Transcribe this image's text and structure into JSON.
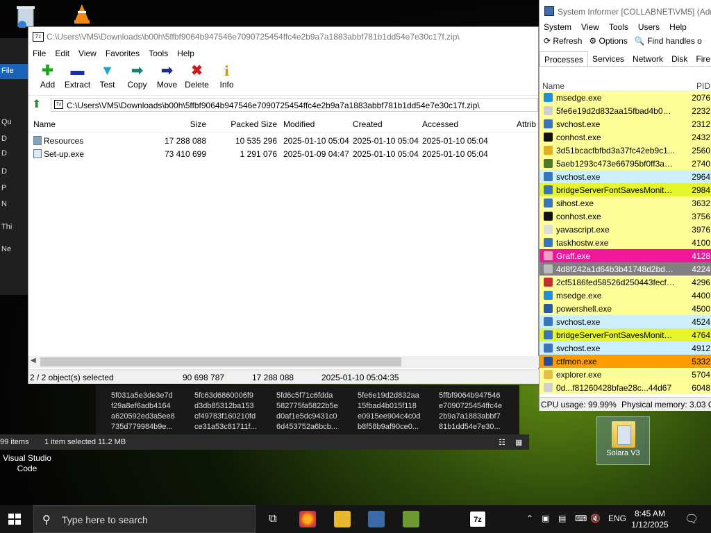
{
  "desktop": {
    "solara_label": "Solara V3",
    "vs_label": "Visual Studio Code"
  },
  "explorer_bg": {
    "file_tab": "File",
    "nav_items": [
      "Qu",
      "D",
      "D",
      "D",
      "P",
      "N",
      "Thi",
      "Ne"
    ],
    "status_items": "99 items",
    "status_selected": "1 item selected  11.2 MB",
    "hash_cols": [
      "5f031a5e3de3e7d\nf29a8ef6adb4164\na620592ed3a5ee8\n735d779984b9e...",
      "5fc63d6860006f9\nd3db85312ba153\ncf49783f160210fd\nce31a53c81711f...",
      "5fd6c5f71c6fdda\n582775fa5822b5e\nd0af1e5dc9431c0\n6d453752a6bcb...",
      "5fe6e19d2d832aa\n15fbad4b015f118\ne0915ee904c4c0d\nb8f58b9af90ce0...",
      "5ffbf9064b947546\ne7090725454ffc4e\n2b9a7a1883abbf7\n81b1dd54e7e30..."
    ]
  },
  "zip": {
    "title": "C:\\Users\\VM5\\Downloads\\b00h\\5ffbf9064b947546e7090725454ffc4e2b9a7a1883abbf781b1dd54e7e30c17f.zip\\",
    "logo": "7z",
    "menu": [
      "File",
      "Edit",
      "View",
      "Favorites",
      "Tools",
      "Help"
    ],
    "toolbar": [
      {
        "label": "Add",
        "icon": "+",
        "color": "#1fa51f"
      },
      {
        "label": "Extract",
        "icon": "▬",
        "color": "#1a2fb0"
      },
      {
        "label": "Test",
        "icon": "▼",
        "color": "#1fa9c9"
      },
      {
        "label": "Copy",
        "icon": "➡",
        "color": "#17807a"
      },
      {
        "label": "Move",
        "icon": "➡",
        "color": "#1a2a8c"
      },
      {
        "label": "Delete",
        "icon": "✖",
        "color": "#d01818"
      },
      {
        "label": "Info",
        "icon": "i",
        "color": "#c8a000"
      }
    ],
    "address": "C:\\Users\\VM5\\Downloads\\b00h\\5ffbf9064b947546e7090725454ffc4e2b9a7a1883abbf781b1dd54e7e30c17f.zip\\",
    "columns": {
      "name": "Name",
      "size": "Size",
      "packed": "Packed Size",
      "modified": "Modified",
      "created": "Created",
      "accessed": "Accessed",
      "attrib": "Attrib"
    },
    "rows": [
      {
        "name": "Resources",
        "size": "17 288 088",
        "packed": "10 535 296",
        "modified": "2025-01-10 05:04",
        "created": "2025-01-10 05:04",
        "accessed": "2025-01-10 05:04",
        "icon": "folder-icon"
      },
      {
        "name": "Set-up.exe",
        "size": "73 410 699",
        "packed": "1 291 076",
        "modified": "2025-01-09 04:47",
        "created": "2025-01-10 05:04",
        "accessed": "2025-01-10 05:04",
        "icon": "exe-icon"
      }
    ],
    "status": {
      "selected": "2 / 2 object(s) selected",
      "size": "90 698 787",
      "packed": "17 288 088",
      "date": "2025-01-10 05:04:35"
    }
  },
  "si": {
    "title": "System Informer [COLLABNET\\VM5] (Adm",
    "menu": [
      "System",
      "View",
      "Tools",
      "Users",
      "Help"
    ],
    "tools": [
      "⟳ Refresh",
      "⚙ Options",
      "🔍 Find handles o"
    ],
    "tabs": [
      "Processes",
      "Services",
      "Network",
      "Disk",
      "Fire"
    ],
    "col_name": "Name",
    "col_pid": "PID",
    "processes": [
      {
        "name": "msedge.exe",
        "pid": "2076",
        "bg": "#ffff99",
        "ic": "#1e8fd8"
      },
      {
        "name": "5fe6e19d2d832aa15fbad4b015...",
        "pid": "2232",
        "bg": "#ffff99",
        "ic": "#d0d0d0"
      },
      {
        "name": "svchost.exe",
        "pid": "2312",
        "bg": "#ffff99",
        "ic": "#3a76c0"
      },
      {
        "name": "conhost.exe",
        "pid": "2432",
        "bg": "#ffff99",
        "ic": "#111111"
      },
      {
        "name": "3d51bcacfbfbd3a37fc42eb9c1...",
        "pid": "2560",
        "bg": "#ffff99",
        "ic": "#e0b020"
      },
      {
        "name": "5aeb1293c473e66795bf0ff3a78...",
        "pid": "2740",
        "bg": "#ffff99",
        "ic": "#4a7a2a"
      },
      {
        "name": "svchost.exe",
        "pid": "2964",
        "bg": "#cdf0ff",
        "ic": "#3a76c0"
      },
      {
        "name": "bridgeServerFontSavesMonito...",
        "pid": "2984",
        "bg": "#e6f52c",
        "ic": "#3a76c0"
      },
      {
        "name": "sihost.exe",
        "pid": "3632",
        "bg": "#ffff99",
        "ic": "#3a76c0"
      },
      {
        "name": "conhost.exe",
        "pid": "3756",
        "bg": "#ffff99",
        "ic": "#111111"
      },
      {
        "name": "yavascript.exe",
        "pid": "3976",
        "bg": "#ffff99",
        "ic": "#dddddd"
      },
      {
        "name": "taskhostw.exe",
        "pid": "4100",
        "bg": "#ffff99",
        "ic": "#3a76c0"
      },
      {
        "name": "Graff.exe",
        "pid": "4128",
        "bg": "#f0179a",
        "ic": "#f0a0c0"
      },
      {
        "name": "4d8f242a1d64b3b41748d2bd5...",
        "pid": "4224",
        "bg": "#808080",
        "ic": "#bbbbbb"
      },
      {
        "name": "2cf5186fed58526d250443fecf2...",
        "pid": "4296",
        "bg": "#ffff99",
        "ic": "#c83030"
      },
      {
        "name": "msedge.exe",
        "pid": "4400",
        "bg": "#ffff99",
        "ic": "#1e8fd8"
      },
      {
        "name": "powershell.exe",
        "pid": "4500",
        "bg": "#ffff99",
        "ic": "#2b5aa8"
      },
      {
        "name": "svchost.exe",
        "pid": "4524",
        "bg": "#cdf0ff",
        "ic": "#3a76c0"
      },
      {
        "name": "bridgeServerFontSavesMonito...",
        "pid": "4764",
        "bg": "#e6f52c",
        "ic": "#3a76c0"
      },
      {
        "name": "svchost.exe",
        "pid": "4912",
        "bg": "#cdf0ff",
        "ic": "#3a76c0"
      },
      {
        "name": "ctfmon.exe",
        "pid": "5332",
        "bg": "#ff9d00",
        "ic": "#2050a0"
      },
      {
        "name": "explorer.exe",
        "pid": "5704",
        "bg": "#ffff99",
        "ic": "#e8c040"
      },
      {
        "name": "0d...f81260428bfae28c...44d67",
        "pid": "6048",
        "bg": "#ffff99",
        "ic": "#d0d0d0"
      }
    ],
    "cpu": "CPU usage: 99.99%",
    "memory": "Physical memory: 3.03 G"
  },
  "taskbar": {
    "search_placeholder": "Type here to search",
    "lang": "ENG",
    "time": "8:45 AM",
    "date": "1/12/2025",
    "zip_app": "7z"
  }
}
